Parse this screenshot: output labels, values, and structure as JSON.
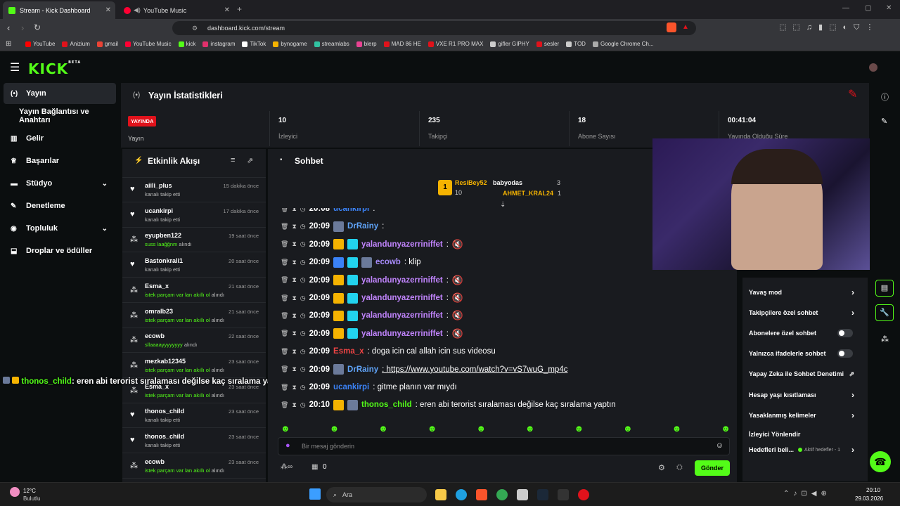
{
  "browser": {
    "tabs": [
      {
        "title": "Stream - Kick Dashboard"
      },
      {
        "title": "YouTube Music"
      }
    ],
    "url": "dashboard.kick.com/stream",
    "bookmarks": [
      "YouTube",
      "Anizium",
      "gmail",
      "YouTube Music",
      "kick",
      "instagram",
      "TikTok",
      "bynogame",
      "streamlabs",
      "blerp",
      "MAD 86 HE",
      "VXE R1 PRO MAX",
      "gifler GIPHY",
      "sesler",
      "TOD",
      "Google Chrome Ch..."
    ]
  },
  "brand": {
    "logo": "KICK",
    "beta": "BETA"
  },
  "sidebar": {
    "items": [
      {
        "label": "Yayın",
        "icon": "broadcast-icon"
      },
      {
        "label": "Yayın Bağlantısı ve Anahtarı",
        "icon": ""
      },
      {
        "label": "Gelir",
        "icon": "chart-icon"
      },
      {
        "label": "Başarılar",
        "icon": "trophy-icon"
      },
      {
        "label": "Stüdyo",
        "icon": "studio-icon"
      },
      {
        "label": "Denetleme",
        "icon": "wrench-icon"
      },
      {
        "label": "Topluluk",
        "icon": "community-icon"
      },
      {
        "label": "Droplar ve ödüller",
        "icon": "gift-icon"
      }
    ]
  },
  "stats": {
    "title": "Yayın İstatistikleri",
    "live_badge": "YAYINDA",
    "live_label": "Yayın",
    "cells": [
      {
        "value": "10",
        "label": "İzleyici"
      },
      {
        "value": "235",
        "label": "Takipçi"
      },
      {
        "value": "18",
        "label": "Abone Sayısı"
      },
      {
        "value": "00:41:04",
        "label": "Yayında Olduğu Süre"
      }
    ]
  },
  "activity": {
    "title": "Etkinlik Akışı",
    "items": [
      {
        "name": "aiili_plus",
        "sub": "kanalı takip etti",
        "subg": "",
        "time": "15 dakika önce",
        "icon": "heart"
      },
      {
        "name": "ucankirpi",
        "sub": "kanalı takip etti",
        "subg": "",
        "time": "17 dakika önce",
        "icon": "heart"
      },
      {
        "name": "eyupben122",
        "sub": " alındı",
        "subg": "suss laağğnm",
        "time": "19 saat önce",
        "icon": "points"
      },
      {
        "name": "Bastonkrali1",
        "sub": "kanalı takip etti",
        "subg": "",
        "time": "20 saat önce",
        "icon": "heart"
      },
      {
        "name": "Esma_x",
        "sub": " alındı",
        "subg": "istek parçam var lan akıllı ol",
        "time": "21 saat önce",
        "icon": "points"
      },
      {
        "name": "omralb23",
        "sub": " alındı",
        "subg": "istek parçam var lan akıllı ol",
        "time": "21 saat önce",
        "icon": "points"
      },
      {
        "name": "ecowb",
        "sub": " alındı",
        "subg": "sllaaaayyyyyyyy",
        "time": "22 saat önce",
        "icon": "points"
      },
      {
        "name": "mezkab12345",
        "sub": " alındı",
        "subg": "istek parçam var lan akıllı ol",
        "time": "23 saat önce",
        "icon": "points"
      },
      {
        "name": "Esma_x",
        "sub": " alındı",
        "subg": "istek parçam var lan akıllı ol",
        "time": "23 saat önce",
        "icon": "points"
      },
      {
        "name": "thonos_child",
        "sub": "kanalı takip etti",
        "subg": "",
        "time": "23 saat önce",
        "icon": "heart"
      },
      {
        "name": "thonos_child",
        "sub": "kanalı takip etti",
        "subg": "",
        "time": "23 saat önce",
        "icon": "heart"
      },
      {
        "name": "ecowb",
        "sub": " alındı",
        "subg": "istek parçam var lan akıllı ol",
        "time": "23 saat önce",
        "icon": "points"
      }
    ]
  },
  "overlay_msg": {
    "user": "thonos_child",
    "text": ": eren abi terorist sıralaması değilse kaç sıralama yaptın"
  },
  "chat": {
    "title": "Sohbet",
    "leaders": [
      {
        "rank": "1",
        "name": "ResiBey52",
        "count": "10"
      },
      {
        "name": "babyodas",
        "count": "3"
      },
      {
        "name": "AHMET_KRAL24",
        "count": "1"
      }
    ],
    "messages": [
      {
        "time": "20:08",
        "user": "ucankirpi",
        "color": "#3b82f6",
        "text": ":",
        "badges": []
      },
      {
        "time": "20:09",
        "user": "DrRainy",
        "color": "#60a5fa",
        "text": ":",
        "badges": [
          "#6b7a9a"
        ]
      },
      {
        "time": "20:09",
        "user": "yalandunyazerriniffet",
        "color": "#c084fc",
        "text": ":",
        "badges": [
          "#f5b301",
          "#22d3ee"
        ]
      },
      {
        "time": "20:09",
        "user": "ecowb",
        "color": "#a78bfa",
        "text": ": klip",
        "badges": [
          "#3b82f6",
          "#22d3ee",
          "#6b7a9a"
        ]
      },
      {
        "time": "20:09",
        "user": "yalandunyazerriniffet",
        "color": "#c084fc",
        "text": ":",
        "badges": [
          "#f5b301",
          "#22d3ee"
        ]
      },
      {
        "time": "20:09",
        "user": "yalandunyazerriniffet",
        "color": "#c084fc",
        "text": ":",
        "badges": [
          "#f5b301",
          "#22d3ee"
        ]
      },
      {
        "time": "20:09",
        "user": "yalandunyazerriniffet",
        "color": "#c084fc",
        "text": ":",
        "badges": [
          "#f5b301",
          "#22d3ee"
        ]
      },
      {
        "time": "20:09",
        "user": "yalandunyazerriniffet",
        "color": "#c084fc",
        "text": ":",
        "badges": [
          "#f5b301",
          "#22d3ee"
        ]
      },
      {
        "time": "20:09",
        "user": "Esma_x",
        "color": "#ef4444",
        "text": ": doga icin cal allah icin sus videosu",
        "badges": []
      },
      {
        "time": "20:09",
        "user": "DrRainy",
        "color": "#60a5fa",
        "text": ": https://www.youtube.com/watch?v=vS7wuG_mp4c",
        "badges": [
          "#6b7a9a"
        ]
      },
      {
        "time": "20:09",
        "user": "ucankirpi",
        "color": "#3b82f6",
        "text": ": gitme planın var mıydı",
        "badges": []
      },
      {
        "time": "20:10",
        "user": "thonos_child",
        "color": "#53fc18",
        "text": ": eren abi terorist sıralaması değilse kaç sıralama yaptın",
        "badges": [
          "#f5b301",
          "#6b7a9a"
        ]
      }
    ],
    "placeholder": "Bir mesaj gönderin",
    "points": "0",
    "send": "Gönder"
  },
  "settings": [
    {
      "label": "Yavaş mod",
      "ctrl": "arrow"
    },
    {
      "label": "Takipçilere özel sohbet",
      "ctrl": "arrow"
    },
    {
      "label": "Abonelere özel sohbet",
      "ctrl": "toggle"
    },
    {
      "label": "Yalnızca ifadelerle sohbet",
      "ctrl": "toggle"
    },
    {
      "label": "Yapay Zeka ile Sohbet Denetimi",
      "ctrl": "ext"
    },
    {
      "label": "Hesap yaşı kısıtlaması",
      "ctrl": "arrow"
    },
    {
      "label": "Yasaklanmış kelimeler",
      "ctrl": "arrow"
    },
    {
      "label": "İzleyici Yönlendir",
      "ctrl": ""
    },
    {
      "label": "Hedefleri beli...",
      "ctrl": "arrow",
      "note": "Aktif hedefler - 1"
    }
  ],
  "taskbar": {
    "weather_temp": "12°C",
    "weather_desc": "Bulutlu",
    "search": "Ara",
    "time": "20:10",
    "date": "29.03.2026"
  },
  "colors": {
    "accent": "#53fc18",
    "bg": "#0b0e0f",
    "panel": "#191b1f",
    "live": "#e0121b"
  }
}
